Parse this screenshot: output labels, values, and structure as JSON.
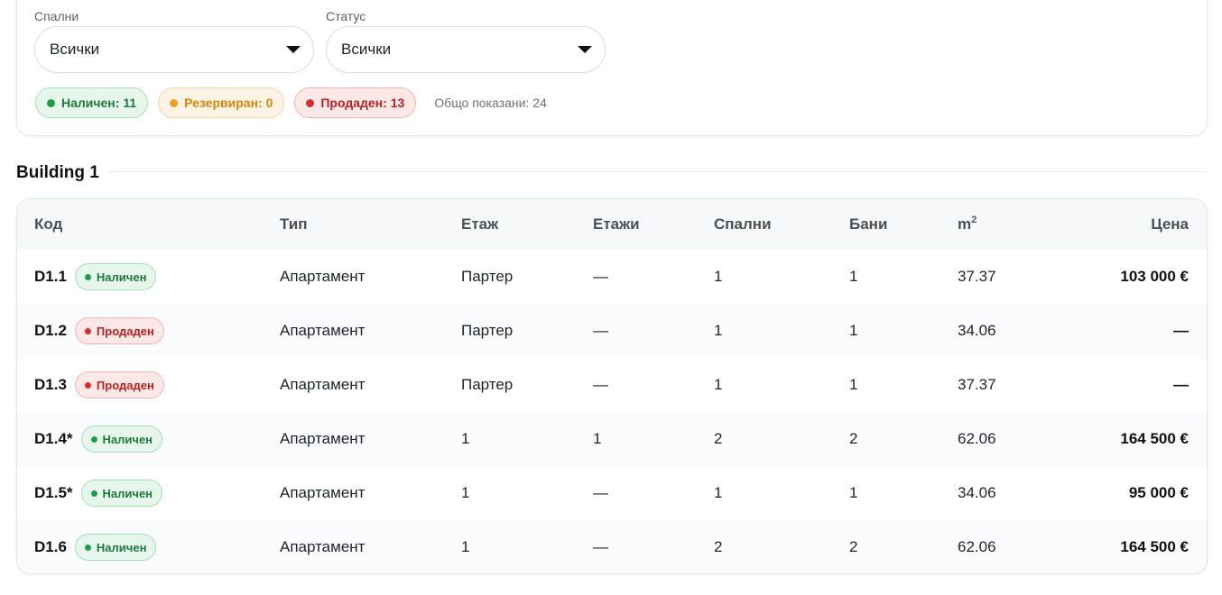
{
  "filters": {
    "bedrooms": {
      "label": "Спални",
      "value": "Всички"
    },
    "status": {
      "label": "Статус",
      "value": "Всички"
    }
  },
  "summary": {
    "available": "Наличен: 11",
    "reserved": "Резервиран: 0",
    "sold": "Продаден: 13",
    "total": "Общо показани: 24"
  },
  "colors": {
    "available": "#1f9d4a",
    "reserved": "#f0a020",
    "sold": "#d62d2d"
  },
  "building": {
    "title": "Building 1",
    "columns": {
      "code": "Код",
      "type": "Тип",
      "floor": "Етаж",
      "floors": "Етажи",
      "bedrooms": "Спални",
      "bathrooms": "Бани",
      "area": "m",
      "area_sup": "2",
      "price": "Цена"
    },
    "rows": [
      {
        "code": "D1.1",
        "status": "Наличен",
        "type": "Апартамент",
        "floor": "Партер",
        "floors": "—",
        "bedrooms": "1",
        "bathrooms": "1",
        "area": "37.37",
        "price": "103 000 €"
      },
      {
        "code": "D1.2",
        "status": "Продаден",
        "type": "Апартамент",
        "floor": "Партер",
        "floors": "—",
        "bedrooms": "1",
        "bathrooms": "1",
        "area": "34.06",
        "price": "—"
      },
      {
        "code": "D1.3",
        "status": "Продаден",
        "type": "Апартамент",
        "floor": "Партер",
        "floors": "—",
        "bedrooms": "1",
        "bathrooms": "1",
        "area": "37.37",
        "price": "—"
      },
      {
        "code": "D1.4*",
        "status": "Наличен",
        "type": "Апартамент",
        "floor": "1",
        "floors": "1",
        "bedrooms": "2",
        "bathrooms": "2",
        "area": "62.06",
        "price": "164 500 €"
      },
      {
        "code": "D1.5*",
        "status": "Наличен",
        "type": "Апартамент",
        "floor": "1",
        "floors": "—",
        "bedrooms": "1",
        "bathrooms": "1",
        "area": "34.06",
        "price": "95 000 €"
      },
      {
        "code": "D1.6",
        "status": "Наличен",
        "type": "Апартамент",
        "floor": "1",
        "floors": "—",
        "bedrooms": "2",
        "bathrooms": "2",
        "area": "62.06",
        "price": "164 500 €"
      }
    ]
  }
}
